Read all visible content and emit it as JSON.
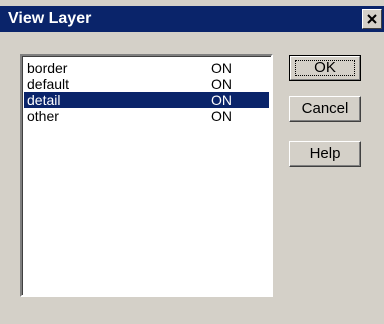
{
  "window": {
    "title": "View Layer",
    "close_icon": "close-icon"
  },
  "layers": [
    {
      "name": "border",
      "state": "ON",
      "selected": false
    },
    {
      "name": "default",
      "state": "ON",
      "selected": false
    },
    {
      "name": "detail",
      "state": "ON",
      "selected": true
    },
    {
      "name": "other",
      "state": "ON",
      "selected": false
    }
  ],
  "buttons": {
    "ok_label": "OK",
    "cancel_label": "Cancel",
    "help_label": "Help"
  },
  "colors": {
    "titlebar": "#0a246a",
    "selection": "#0a246a",
    "dialog_bg": "#d4d0c8"
  }
}
